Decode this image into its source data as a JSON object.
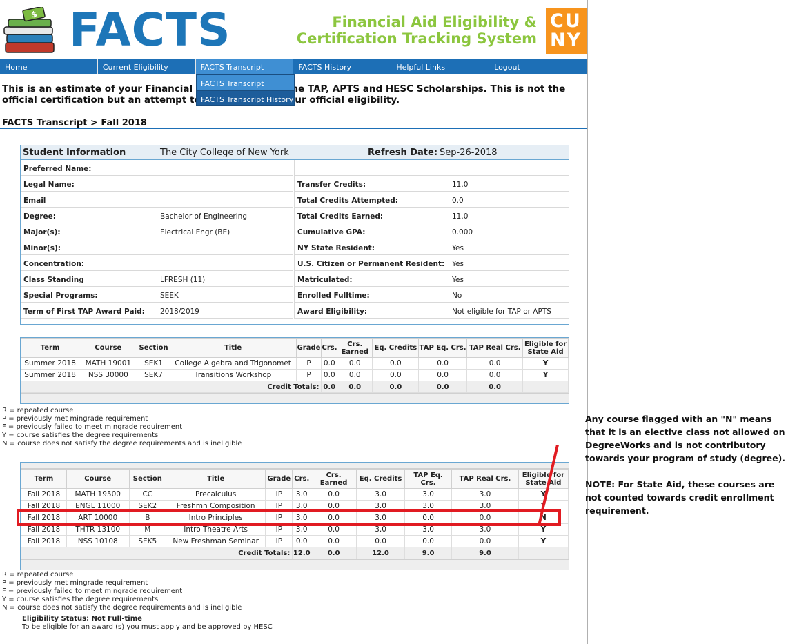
{
  "header": {
    "logo_text": "FACTS",
    "tagline_line1": "Financial Aid Eligibility &",
    "tagline_line2": "Certification Tracking System",
    "cuny_line1": "CU",
    "cuny_line2": "NY"
  },
  "nav": {
    "items": [
      "Home",
      "Current Eligibility",
      "FACTS Transcript",
      "FACTS History",
      "Helpful Links",
      "Logout"
    ],
    "dropdown": [
      "FACTS Transcript",
      "FACTS Transcript History"
    ]
  },
  "intro": "This is an estimate of your Financial Aid eligibility for the TAP, APTS and HESC Scholarships. This is not the official certification but an attempt to reflect what is your official eligibility.",
  "breadcrumb": "FACTS Transcript > Fall 2018",
  "student": {
    "heading": "Student Information",
    "college": "The City College of New York",
    "refresh_label": "Refresh Date:",
    "refresh_date": "Sep-26-2018",
    "rows": [
      {
        "l1": "Preferred Name:",
        "v1": "",
        "l2": "",
        "v2": ""
      },
      {
        "l1": "Legal Name:",
        "v1": "",
        "l2": "Transfer Credits:",
        "v2": "11.0"
      },
      {
        "l1": "Email",
        "v1": "",
        "l2": "Total Credits Attempted:",
        "v2": "0.0"
      },
      {
        "l1": "Degree:",
        "v1": "Bachelor of Engineering",
        "l2": "Total Credits Earned:",
        "v2": "11.0"
      },
      {
        "l1": "Major(s):",
        "v1": "Electrical Engr (BE)",
        "l2": "Cumulative GPA:",
        "v2": "0.000"
      },
      {
        "l1": "Minor(s):",
        "v1": "",
        "l2": "NY State Resident:",
        "v2": "Yes"
      },
      {
        "l1": "Concentration:",
        "v1": "",
        "l2": "U.S. Citizen or Permanent Resident:",
        "v2": "Yes"
      },
      {
        "l1": "Class Standing",
        "v1": "LFRESH (11)",
        "l2": "Matriculated:",
        "v2": "Yes"
      },
      {
        "l1": "Special Programs:",
        "v1": "SEEK",
        "l2": "Enrolled Fulltime:",
        "v2": "No"
      },
      {
        "l1": "Term of First TAP Award Paid:",
        "v1": "2018/2019",
        "l2": "Award Eligibility:",
        "v2": "Not eligible for TAP or APTS"
      }
    ]
  },
  "columns": [
    "Term",
    "Course",
    "Section",
    "Title",
    "Grade",
    "Crs.",
    "Crs. Earned",
    "Eq. Credits",
    "TAP Eq. Crs.",
    "TAP Real Crs.",
    "Eligible for State Aid"
  ],
  "table1": {
    "rows": [
      [
        "Summer 2018",
        "MATH 19001",
        "SEK1",
        "College Algebra and Trigonomet",
        "P",
        "0.0",
        "0.0",
        "0.0",
        "0.0",
        "0.0",
        "Y"
      ],
      [
        "Summer 2018",
        "NSS 30000",
        "SEK7",
        "Transitions Workshop",
        "P",
        "0.0",
        "0.0",
        "0.0",
        "0.0",
        "0.0",
        "Y"
      ]
    ],
    "totals_label": "Credit Totals:",
    "totals": [
      "0.0",
      "0.0",
      "0.0",
      "0.0",
      "0.0"
    ]
  },
  "table2": {
    "rows": [
      [
        "Fall 2018",
        "MATH 19500",
        "CC",
        "Precalculus",
        "IP",
        "3.0",
        "0.0",
        "3.0",
        "3.0",
        "3.0",
        "Y"
      ],
      [
        "Fall 2018",
        "ENGL 11000",
        "SEK2",
        "Freshmn Composition",
        "IP",
        "3.0",
        "0.0",
        "3.0",
        "3.0",
        "3.0",
        "Y"
      ],
      [
        "Fall 2018",
        "ART 10000",
        "B",
        "Intro Principles",
        "IP",
        "3.0",
        "0.0",
        "3.0",
        "0.0",
        "0.0",
        "N"
      ],
      [
        "Fall 2018",
        "THTR 13100",
        "M",
        "Intro Theatre Arts",
        "IP",
        "3.0",
        "0.0",
        "3.0",
        "3.0",
        "3.0",
        "Y"
      ],
      [
        "Fall 2018",
        "NSS 10108",
        "SEK5",
        "New Freshman Seminar",
        "IP",
        "0.0",
        "0.0",
        "0.0",
        "0.0",
        "0.0",
        "Y"
      ]
    ],
    "totals_label": "Credit Totals:",
    "totals": [
      "12.0",
      "0.0",
      "12.0",
      "9.0",
      "9.0"
    ]
  },
  "legend": [
    "R = repeated course",
    "P = previously met mingrade requirement",
    "F = previously failed to meet mingrade requirement",
    "Y = course satisfies the degree requirements",
    "N = course does not satisfy the degree requirements and is ineligible"
  ],
  "eligibility": {
    "status": "Eligibility Status: Not Full-time",
    "text": "To be eligible for an award (s) you must apply and be approved by HESC"
  },
  "annotation": {
    "p1": "Any course flagged with an \"N\" means that it is an elective class not allowed on DegreeWorks and is not contributory towards your program of study (degree).",
    "p2": "NOTE: For State Aid, these courses are not counted towards credit enrollment requirement."
  },
  "colors": {
    "brand_blue": "#1d76b8",
    "tagline_green": "#8cc63f",
    "cuny_orange": "#f7941d",
    "highlight_red": "#e11b22"
  }
}
